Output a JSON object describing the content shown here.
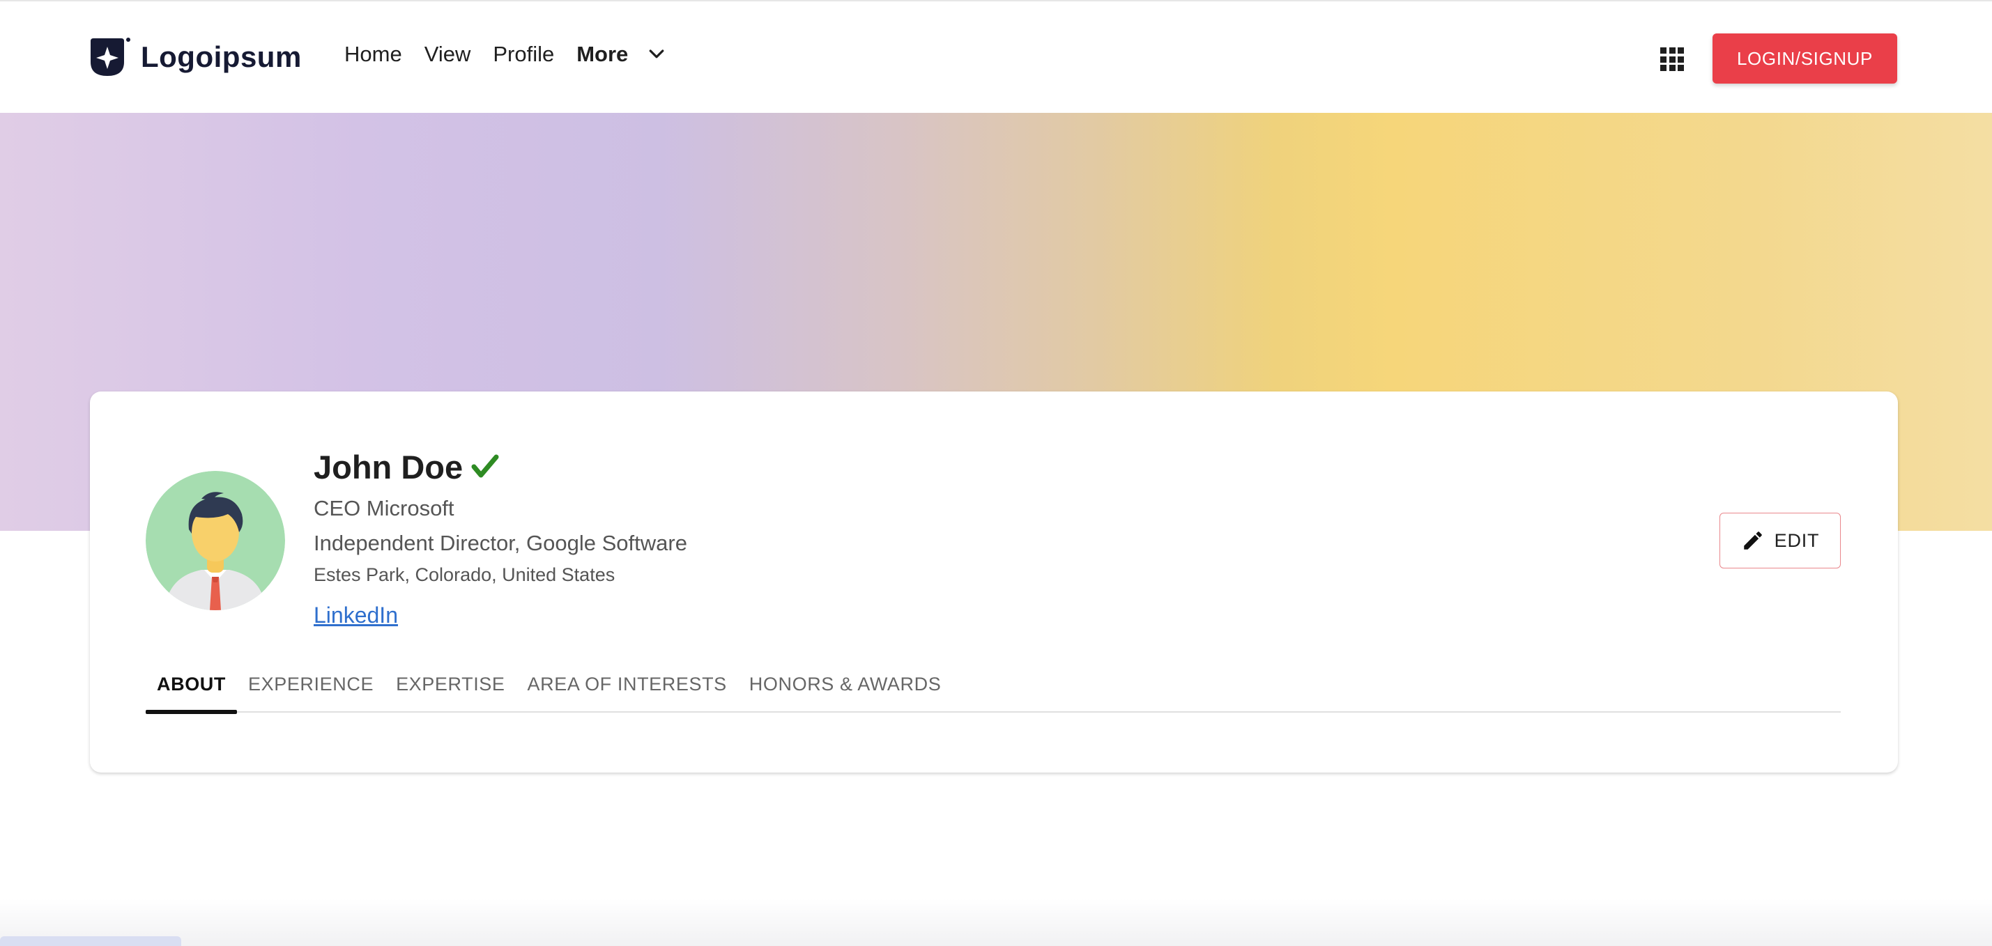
{
  "brand": {
    "name": "Logoipsum"
  },
  "nav": {
    "links": [
      "Home",
      "View",
      "Profile"
    ],
    "more_label": "More"
  },
  "header": {
    "login_label": "LOGIN/SIGNUP"
  },
  "profile": {
    "name": "John Doe",
    "title": "CEO Microsoft",
    "subtitle": "Independent Director, Google Software",
    "location": "Estes Park, Colorado, United States",
    "link_label": "LinkedIn",
    "edit_label": "EDIT"
  },
  "tabs": [
    "ABOUT",
    "EXPERIENCE",
    "EXPERTISE",
    "AREA OF INTERESTS",
    "HONORS & AWARDS"
  ],
  "active_tab": "ABOUT",
  "colors": {
    "accent": "#ea3f49",
    "verified": "#2e8b23",
    "link": "#2f6fcd",
    "brand_dark": "#161a33"
  },
  "icons": {
    "logo": "logo-mark-icon",
    "chevron": "chevron-down-icon",
    "apps": "apps-grid-icon",
    "verified": "check-verified-icon",
    "edit": "pencil-icon"
  }
}
